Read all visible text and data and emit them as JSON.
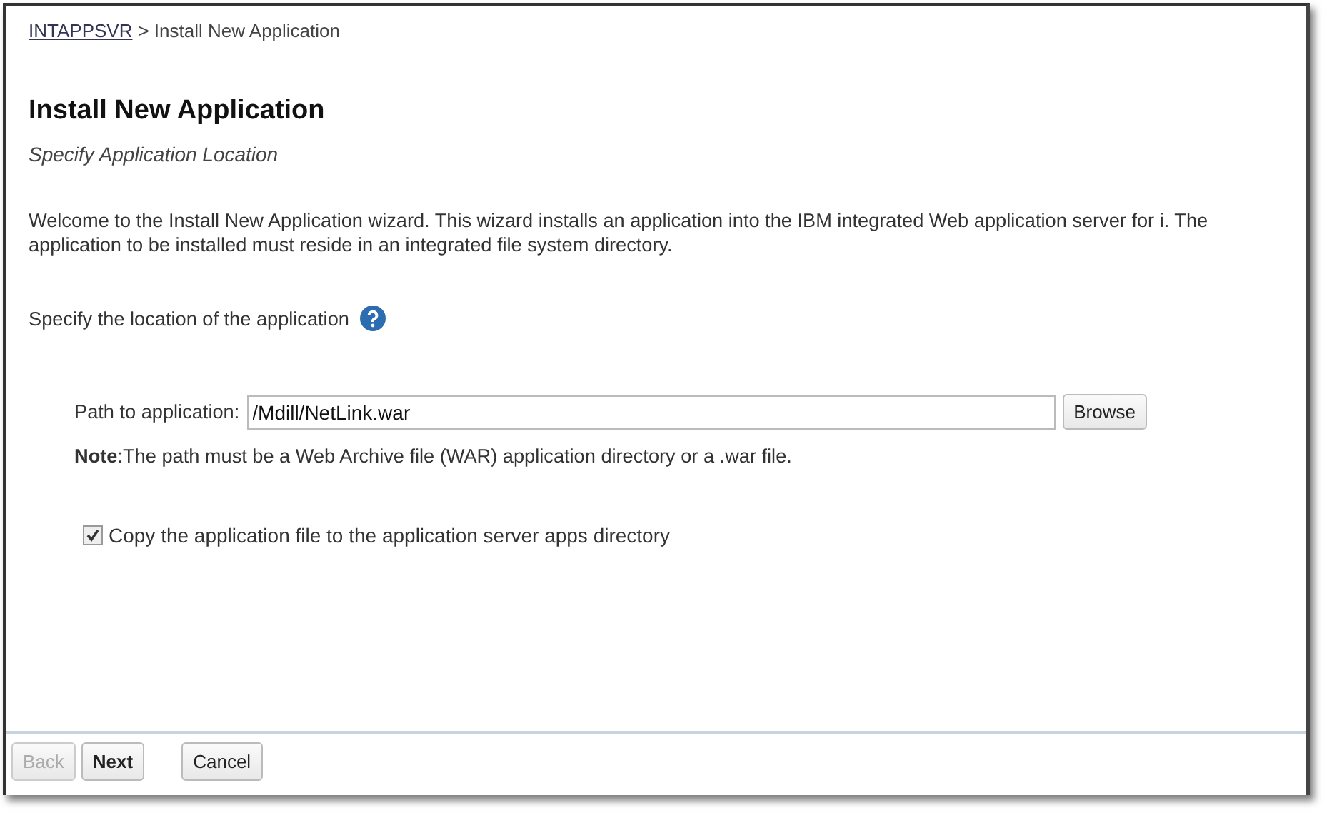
{
  "breadcrumb": {
    "link": "INTAPPSVR",
    "current": "> Install New Application"
  },
  "title": "Install New Application",
  "subtitle": "Specify Application Location",
  "intro": "Welcome to the Install New Application wizard. This wizard installs an application into the IBM integrated Web application server for i. The application to be installed must reside in an integrated file system directory.",
  "location_prompt": "Specify the location of the application",
  "path_field": {
    "label": "Path to application:",
    "value": "/Mdill/NetLink.war",
    "button": "Browse"
  },
  "note": "**Note**:The path must be a Web Archive file (WAR) application directory or a .war file.",
  "copy_option": {
    "label": "Copy the application file to the application server apps directory",
    "checked": true
  },
  "buttons": [
    {
      "label": "Back",
      "disabled": true,
      "default": false
    },
    {
      "label": "Next",
      "disabled": false,
      "default": true
    },
    {
      "label": "Cancel",
      "disabled": false,
      "default": false
    }
  ]
}
